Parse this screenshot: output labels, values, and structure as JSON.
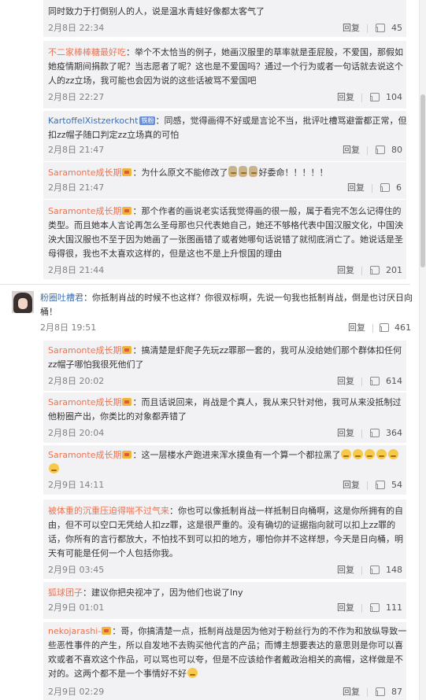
{
  "ui": {
    "reply_label": "回复"
  },
  "comments": [
    {
      "id": "c0",
      "lines": [
        "同时致力于打倒别人的人，说是温水青蛙好像都太客气了"
      ],
      "time": "2月8日 22:34",
      "likes": "45"
    },
    {
      "id": "c1",
      "author": "不二家棒棒糖最好吃",
      "lines": [
        "：举个不太恰当的例子，她画汉服里的草率就是歪屁股，不爱国，那假如",
        "她疫情期间捐款了呢？当志愿者了呢？这也是不爱国吗？通过一个行为或者一句话就去说这个",
        "人的zz立场，我可能也会因为说的这些话被骂不爱国吧"
      ],
      "time": "2月8日 22:27",
      "likes": "104"
    },
    {
      "id": "c2",
      "author": "KartoffelXistzerkocht",
      "badge": "铁粉",
      "lines": [
        "：同感，觉得画得不好或是言论不当，批评吐槽骂避雷都正常，但",
        "扣zz帽子随口判定zz立场真的可怕"
      ],
      "time": "2月8日 21:47",
      "likes": "80"
    },
    {
      "id": "c3",
      "author": "Saramonte成长期",
      "lines": [
        "：为什么原文不能修改了",
        "好委命！！！！！"
      ],
      "time": "2月8日 21:47",
      "likes": "6"
    },
    {
      "id": "c4",
      "author": "Saramonte成长期",
      "lines": [
        "：那个作者的画说老实话我觉得画的很一般，属于看完不怎么记得住的",
        "类型。而且她本人言论再怎么圣母那也只代表她自己，她还不够格代表中国汉服文化，中国泱",
        "泱大国汉服也不至于因为她画了一张图画错了或者她哪句话说错了就彻底消亡了。她说话是圣",
        "母得很，我也不太喜欢这样的，但是这也不是上升恨国的理由"
      ],
      "time": "2月8日 21:44",
      "likes": "201"
    },
    {
      "id": "c5",
      "author": "粉圈吐槽君",
      "lines": [
        "：你抵制肖战的时候不也这样？你很双标啊，先说一句我也抵制肖战，倒是也讨厌日向",
        "桶！"
      ],
      "time": "2月8日 19:51",
      "likes": "461"
    },
    {
      "id": "c6",
      "author": "Saramonte成长期",
      "lines": [
        "：搞清楚是虾爬子先玩zz罪那一套的，我可从没给她们那个群体扣任何",
        "zz帽子哪怕我很死他们了"
      ],
      "time": "2月8日 20:02",
      "likes": "614"
    },
    {
      "id": "c7",
      "author": "Saramonte成长期",
      "lines": [
        "：而且话说回来，肖战是个真人，我从来只针对他，我可从来没抵制过",
        "他粉圈产出，你类比的对象都弄错了"
      ],
      "time": "2月8日 20:04",
      "likes": "364"
    },
    {
      "id": "c8",
      "author": "Saramonte成长期",
      "lines": [
        "：这一层楼水产跑进来浑水摸鱼有一个算一个都拉黑了"
      ],
      "time": "2月9日 14:11",
      "likes": "54"
    },
    {
      "id": "c9",
      "author": "被体重的沉重压迫得喘不过气来",
      "lines": [
        "：你也可以像抵制肖战一样抵制日向桶啊，这是你所拥有的自",
        "由，但不可以空口无凭给人扣zz罪，这是很严重的。没有确切的证据指向就可以扣上zz罪的",
        "话，你所有的言行都放大，不怕找不到可以扣的地方，哪怕你并不这样想，今天是日向桶，明",
        "天有可能是任何一个人包括你我。"
      ],
      "time": "2月9日 03:45",
      "likes": "148"
    },
    {
      "id": "c10",
      "author": "狐球团子",
      "lines": [
        "：建议你把央视冲了，因为他们也说了lny"
      ],
      "time": "2月9日 01:01",
      "likes": "111"
    },
    {
      "id": "c11",
      "author": "nekojarashi-",
      "lines": [
        "：哥，你搞清楚一点，抵制肖战是因为他对于粉丝行为的不作为和放纵导致一",
        "些恶性事件的产生，所以自发地不去购买他代言的产品；而博主想要表达的意思则是你可以喜",
        "欢或者不喜欢这个作品，可以骂也可以夸，但是不应该给作者戴政治相关的高帽，这样做是不",
        "对的。这两个都不是一个事情好不好"
      ],
      "time": "2月9日 02:29",
      "likes": "87"
    }
  ],
  "colors": {
    "author": "#eb7350",
    "author_link": "#3b6fb6",
    "sub_bg": "#f2f2f5",
    "meta": "#808080",
    "badge": "#6a8ed8"
  },
  "icons": [
    "thumbs-up-icon",
    "crown-badge-icon",
    "emoji-icon",
    "avatar"
  ]
}
